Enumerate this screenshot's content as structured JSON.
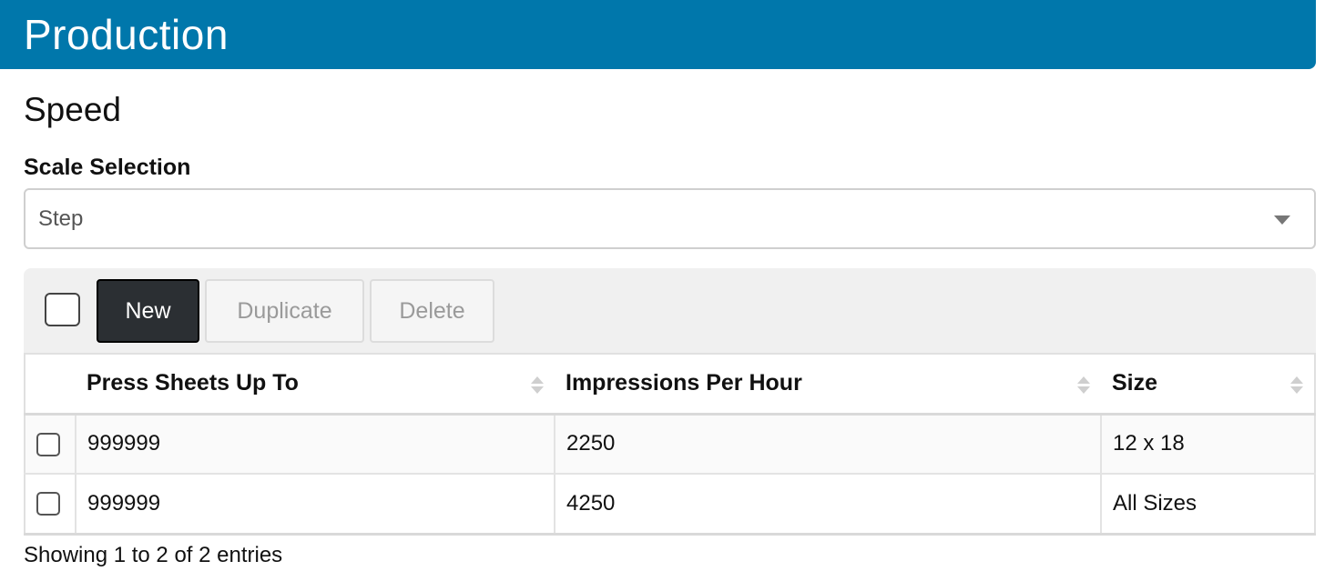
{
  "header": {
    "title": "Production",
    "bg_color": "#0077ab"
  },
  "section": {
    "title": "Speed"
  },
  "scale_selection": {
    "label": "Scale Selection",
    "value": "Step"
  },
  "toolbar": {
    "new_label": "New",
    "duplicate_label": "Duplicate",
    "delete_label": "Delete"
  },
  "table": {
    "columns": [
      "Press Sheets Up To",
      "Impressions Per Hour",
      "Size"
    ],
    "rows": [
      {
        "press_sheets_up_to": "999999",
        "impressions_per_hour": "2250",
        "size": "12 x 18"
      },
      {
        "press_sheets_up_to": "999999",
        "impressions_per_hour": "4250",
        "size": "All Sizes"
      }
    ]
  },
  "footer": {
    "info": "Showing 1 to 2 of 2 entries"
  },
  "icons": {
    "sort": "sort-icon",
    "dropdown": "chevron-down-icon"
  }
}
